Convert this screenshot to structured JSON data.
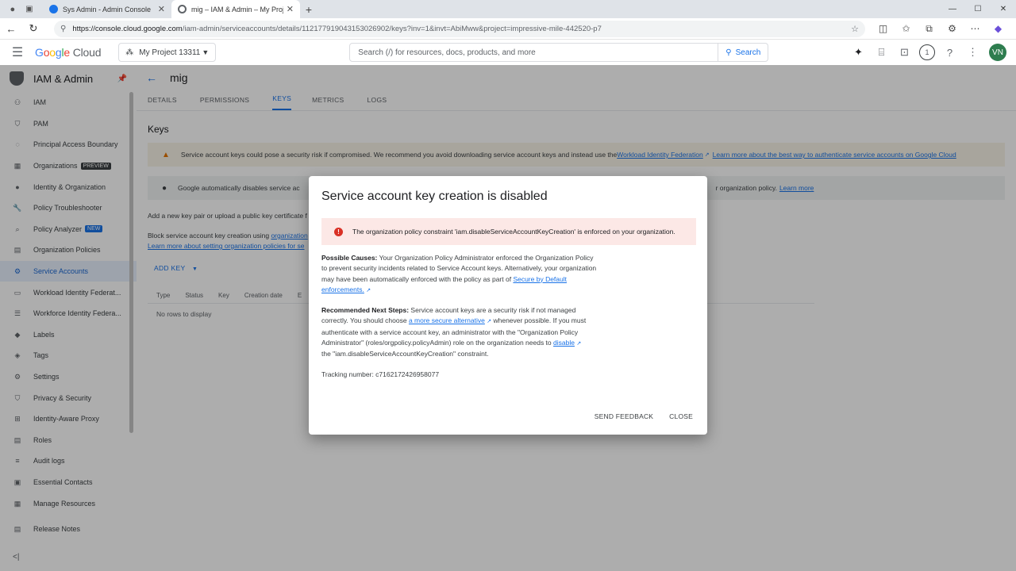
{
  "browser": {
    "tabs": [
      {
        "title": "Sys Admin - Admin Console",
        "active": false
      },
      {
        "title": "mig – IAM & Admin – My Project",
        "active": true
      }
    ],
    "new_tab": "+",
    "url_host": "https://console.cloud.google.com",
    "url_path": "/iam-admin/serviceaccounts/details/112177919043153026902/keys?inv=1&invt=AbiMww&project=impressive-mile-442520-p7"
  },
  "header": {
    "logo_google": [
      "G",
      "o",
      "o",
      "g",
      "l",
      "e"
    ],
    "logo_cloud": "Cloud",
    "project": "My Project 13311",
    "search_placeholder": "Search (/) for resources, docs, products, and more",
    "search_button": "Search",
    "notification_count": "1",
    "avatar": "VN"
  },
  "sidebar": {
    "title": "IAM & Admin",
    "items": [
      {
        "label": "IAM",
        "icon": "person-add-icon"
      },
      {
        "label": "PAM",
        "icon": "shield-icon"
      },
      {
        "label": "Principal Access Boundary",
        "icon": "boundary-icon"
      },
      {
        "label": "Organizations",
        "icon": "organization-icon",
        "badge": "PREVIEW"
      },
      {
        "label": "Identity & Organization",
        "icon": "account-icon"
      },
      {
        "label": "Policy Troubleshooter",
        "icon": "wrench-icon"
      },
      {
        "label": "Policy Analyzer",
        "icon": "analyzer-icon",
        "badge": "NEW"
      },
      {
        "label": "Organization Policies",
        "icon": "policy-icon"
      },
      {
        "label": "Service Accounts",
        "icon": "service-account-icon",
        "active": true
      },
      {
        "label": "Workload Identity Federat...",
        "icon": "workload-icon"
      },
      {
        "label": "Workforce Identity Federa...",
        "icon": "workforce-icon"
      },
      {
        "label": "Labels",
        "icon": "label-icon"
      },
      {
        "label": "Tags",
        "icon": "tag-icon"
      },
      {
        "label": "Settings",
        "icon": "settings-icon"
      },
      {
        "label": "Privacy & Security",
        "icon": "privacy-icon"
      },
      {
        "label": "Identity-Aware Proxy",
        "icon": "proxy-icon"
      },
      {
        "label": "Roles",
        "icon": "roles-icon"
      },
      {
        "label": "Audit logs",
        "icon": "audit-icon"
      },
      {
        "label": "Essential Contacts",
        "icon": "contacts-icon"
      },
      {
        "label": "Manage Resources",
        "icon": "resources-icon"
      },
      {
        "label": "Release Notes",
        "icon": "notes-icon"
      }
    ],
    "collapse": "<|"
  },
  "main": {
    "title": "mig",
    "tabs": [
      "DETAILS",
      "PERMISSIONS",
      "KEYS",
      "METRICS",
      "LOGS"
    ],
    "active_tab": "KEYS",
    "section_title": "Keys",
    "warning_text": "Service account keys could pose a security risk if compromised. We recommend you avoid downloading service account keys and instead use the ",
    "warning_link1": "Workload Identity Federation",
    "warning_link2": "Learn more about the best way to authenticate service accounts on Google Cloud",
    "info_text_start": "Google automatically disables service ac",
    "info_text_end": "r organization policy.",
    "info_link": "Learn more",
    "add_text": "Add a new key pair or upload a public key certificate f",
    "block_text": "Block service account key creation using ",
    "block_link": "organization",
    "learn_link": "Learn more about setting organization policies for se",
    "add_key": "ADD KEY",
    "columns": [
      "Type",
      "Status",
      "Key",
      "Creation date",
      "E"
    ],
    "empty": "No rows to display"
  },
  "dialog": {
    "title": "Service account key creation is disabled",
    "error": "The organization policy constraint 'iam.disableServiceAccountKeyCreation' is enforced on your organization.",
    "causes_label": "Possible Causes:",
    "causes_text": " Your Organization Policy Administrator enforced the Organization Policy to prevent security incidents related to Service Account keys. Alternatively, your organization may have been automatically enforced with the policy as part of ",
    "causes_link": "Secure by Default enforcements.",
    "steps_label": "Recommended Next Steps:",
    "steps_text1": " Service account keys are a security risk if not managed correctly. You should choose ",
    "steps_link1": "a more secure alternative",
    "steps_text2": " whenever possible. If you must authenticate with a service account key, an administrator with the \"Organization Policy Administrator\" (roles/orgpolicy.policyAdmin) role on the organization needs to ",
    "steps_link2": "disable",
    "steps_text3": " the \"iam.disableServiceAccountKeyCreation\" constraint.",
    "tracking": "Tracking number: c7162172426958077",
    "send_feedback": "SEND FEEDBACK",
    "close": "CLOSE"
  }
}
